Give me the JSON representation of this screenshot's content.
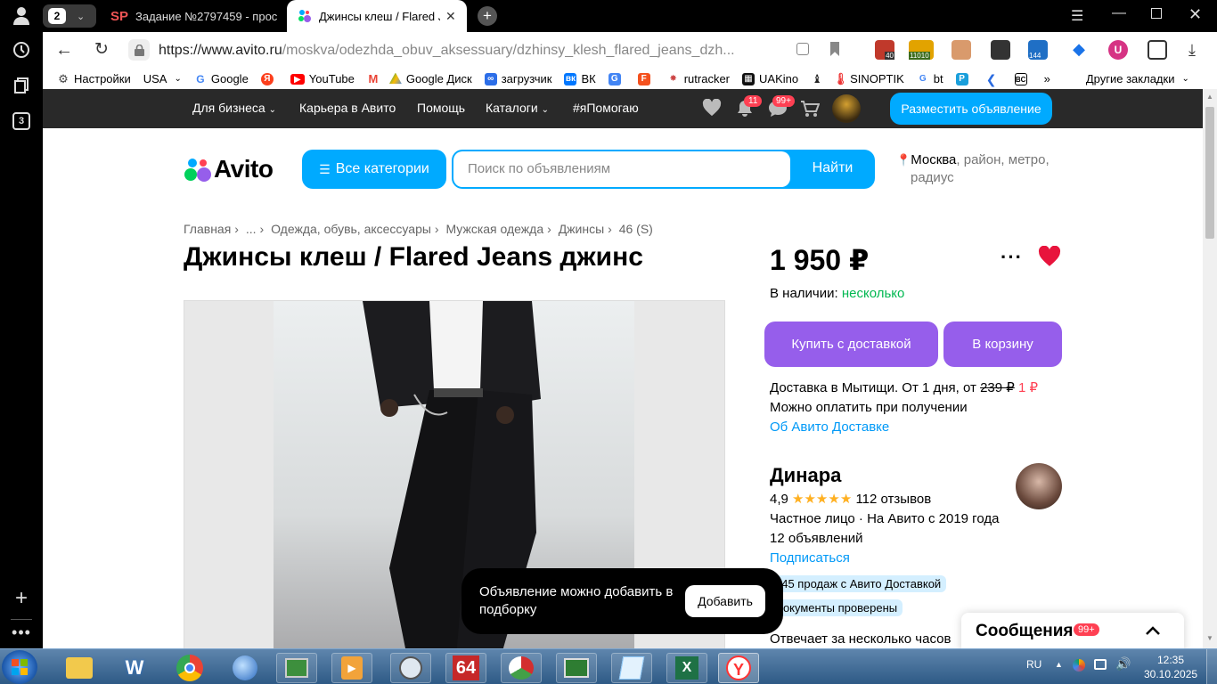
{
  "browser": {
    "tab_count": "2",
    "tabs": [
      {
        "label": "Задание №2797459 - прос",
        "icon_text": "SP"
      },
      {
        "label": "Джинсы клеш / Flared J"
      }
    ],
    "url_domain": "https://www.avito.ru",
    "url_path": "/moskva/odezhda_obuv_aksessuary/dzhinsy_klesh_flared_jeans_dzh...",
    "left_badge": "3"
  },
  "extensions": {
    "badge_1": "40",
    "badge_2": "11010",
    "badge_3": "144"
  },
  "bookmarks": {
    "items": [
      {
        "label": "Настройки"
      },
      {
        "label": "USA"
      },
      {
        "label": "Google"
      },
      {
        "label": ""
      },
      {
        "label": "YouTube"
      },
      {
        "label": ""
      },
      {
        "label": "Google Диск"
      },
      {
        "label": "загрузчик"
      },
      {
        "label": "ВК"
      },
      {
        "label": ""
      },
      {
        "label": ""
      },
      {
        "label": "rutracker"
      },
      {
        "label": "UAKino"
      },
      {
        "label": ""
      },
      {
        "label": "SINOPTIK"
      },
      {
        "label": "bt"
      },
      {
        "label": ""
      },
      {
        "label": ""
      },
      {
        "label": ""
      }
    ],
    "more": "»",
    "other": "Другие закладки"
  },
  "avito_nav": {
    "business": "Для бизнеса",
    "career": "Карьера в Авито",
    "help": "Помощь",
    "catalogs": "Каталоги",
    "help_tag": "#яПомогаю",
    "notif_badge": "11",
    "msg_badge": "99+",
    "post_button": "Разместить объявление"
  },
  "header": {
    "logo": "Avito",
    "categories_button": "Все категории",
    "search_placeholder": "Поиск по объявлениям",
    "search_button": "Найти",
    "location_city": "Москва",
    "location_rest": ", район, метро,",
    "location_rest2": "радиус"
  },
  "breadcrumbs": [
    "Главная",
    "...",
    "Одежда, обувь, аксессуары",
    "Мужская одежда",
    "Джинсы",
    "46 (S)"
  ],
  "listing": {
    "title": "Джинсы клеш / Flared Jeans джинс",
    "price": "1 950 ₽",
    "stock_label": "В наличии:",
    "stock_value": "несколько",
    "buy_button": "Купить с доставкой",
    "cart_button": "В корзину",
    "delivery_text": "Доставка в Мытищи. От 1 дня, от",
    "delivery_old_price": "239 ₽",
    "delivery_new_price": "1 ₽",
    "pay_on_receipt": "Можно оплатить при получении",
    "delivery_link": "Об Авито Доставке"
  },
  "seller": {
    "name": "Динара",
    "rating": "4,9",
    "stars": "★★★★★",
    "reviews": "112 отзывов",
    "type": "Частное лицо · На Авито с 2019 года",
    "ads_count": "12 объявлений",
    "subscribe": "Подписаться",
    "sales_badge": "145 продаж с Авито Доставкой",
    "docs_badge": "Документы проверены",
    "response": "Отвечает за несколько часов"
  },
  "popup": {
    "text": "Объявление можно добавить в подборку",
    "button": "Добавить"
  },
  "messages": {
    "label": "Сообщения",
    "badge": "99+"
  },
  "taskbar": {
    "lang": "RU",
    "time": "12:35",
    "date": "30.10.2025",
    "app_64": "64"
  },
  "colors": {
    "avito_blue": "#00aaff",
    "purple": "#965eeb",
    "green": "#02d15c",
    "red": "#ff4053",
    "link": "#0099f7",
    "heart": "#e8143c"
  }
}
